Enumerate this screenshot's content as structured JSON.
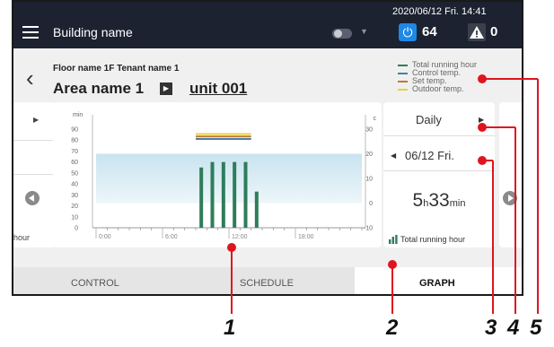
{
  "topbar": {
    "building_name": "Building name",
    "datetime": "2020/06/12 Fri. 14:41",
    "power_count": "64",
    "warning_count": "0"
  },
  "header": {
    "floor_tenant": "Floor name 1F Tenant name 1",
    "area": "Area name 1",
    "unit": "unit 001"
  },
  "legend": [
    {
      "label": "Total running hour",
      "color": "#2e7d5b"
    },
    {
      "label": "Control temp.",
      "color": "#4a7fa8"
    },
    {
      "label": "Set temp.",
      "color": "#c07a30"
    },
    {
      "label": "Outdoor temp.",
      "color": "#e8d040"
    }
  ],
  "side_left": {
    "label": "hour"
  },
  "chart_data": {
    "type": "bar",
    "y_left_unit": "min",
    "y_left_ticks": [
      0,
      10,
      20,
      30,
      40,
      50,
      60,
      70,
      80,
      90
    ],
    "y_right_unit": "c",
    "y_right_ticks": [
      -10,
      0,
      10,
      20,
      30
    ],
    "x_ticks": [
      "0:00",
      "6:00",
      "12:00",
      "18:00"
    ],
    "bars": [
      {
        "hour": 9,
        "value": 55
      },
      {
        "hour": 10,
        "value": 60
      },
      {
        "hour": 11,
        "value": 60
      },
      {
        "hour": 12,
        "value": 60
      },
      {
        "hour": 13,
        "value": 60
      },
      {
        "hour": 14,
        "value": 33
      }
    ],
    "lines": [
      {
        "name": "Set temp.",
        "value": 27,
        "from": 9,
        "to": 14,
        "color": "#c07a30"
      },
      {
        "name": "Outdoor temp.",
        "value": 28,
        "from": 9,
        "to": 14,
        "color": "#e8d040"
      },
      {
        "name": "Control temp.",
        "value": 26,
        "from": 9,
        "to": 14,
        "color": "#4a7fa8"
      }
    ],
    "shade_range": [
      0,
      20
    ]
  },
  "right_card": {
    "period": "Daily",
    "date": "06/12 Fri.",
    "hours": "5",
    "hours_unit": "h",
    "minutes": "33",
    "minutes_unit": "min",
    "label": "Total running hour"
  },
  "tabs": [
    "CONTROL",
    "SCHEDULE",
    "GRAPH"
  ],
  "callouts": [
    "1",
    "2",
    "3",
    "4",
    "5"
  ],
  "colors": {
    "topbar": "#1c2230",
    "accent_blue": "#1e88e5",
    "bar": "#2e7d5b",
    "callout": "#e0141e"
  }
}
